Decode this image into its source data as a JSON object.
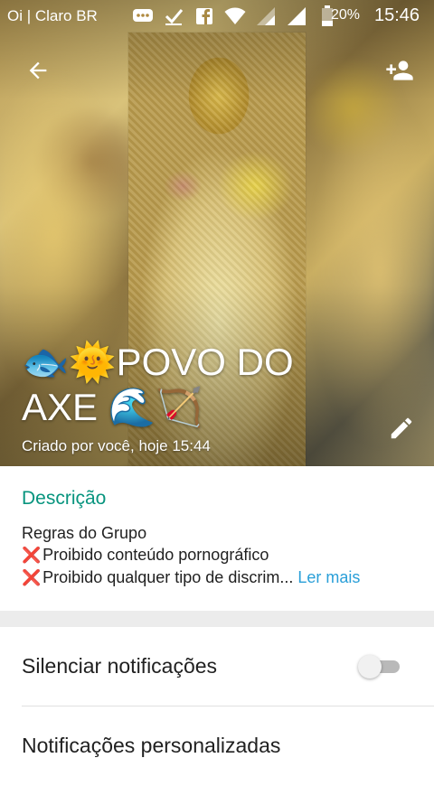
{
  "status_bar": {
    "carrier": "Oi | Claro BR",
    "battery_percent": "20%",
    "time": "15:46",
    "icons": [
      "chat-bubble-icon",
      "checkmark-icon",
      "facebook-icon",
      "wifi-icon",
      "signal-icon",
      "signal-icon",
      "battery-icon"
    ]
  },
  "header": {
    "group_name": "🐟🌞POVO DO AXE 🌊🏹",
    "created_info": "Criado por você, hoje 15:44"
  },
  "description": {
    "label": "Descrição",
    "line1": "Regras do Grupo",
    "line2": "Proibido conteúdo pornográfico",
    "line3": "Proibido qualquer tipo de discrim...",
    "read_more": "Ler mais",
    "bullet": "❌"
  },
  "settings": {
    "mute_label": "Silenciar notificações",
    "mute_enabled": false,
    "custom_notifications_label": "Notificações personalizadas"
  },
  "colors": {
    "accent_teal": "#07947e",
    "link_blue": "#2a9fd8",
    "bullet_red": "#e0322b"
  }
}
